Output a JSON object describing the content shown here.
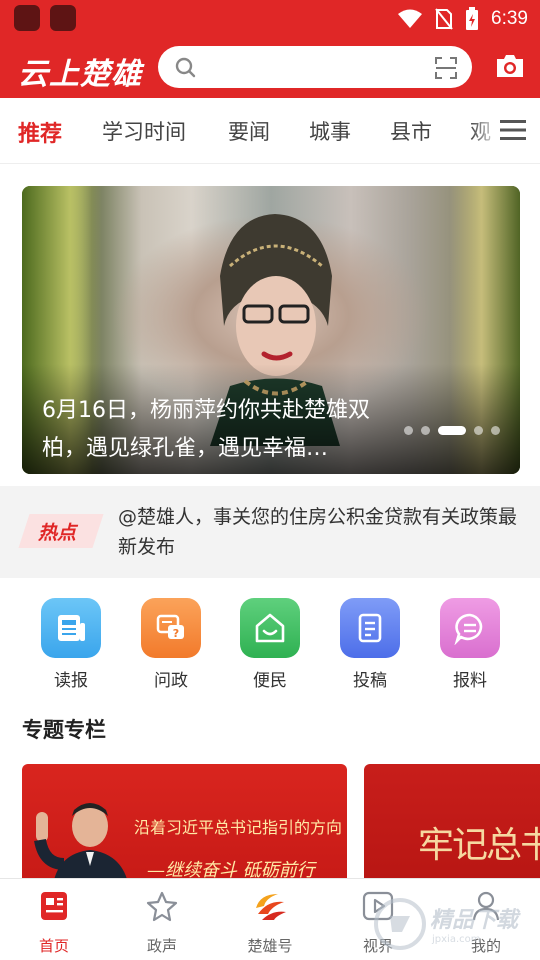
{
  "status_bar": {
    "time": "6:39",
    "icons": [
      "app-icon",
      "app-icon",
      "wifi-icon",
      "no-sim-icon",
      "battery-icon"
    ]
  },
  "header": {
    "app_name": "云上楚雄",
    "search_placeholder": "",
    "icons": [
      "search-icon",
      "scan-icon",
      "camera-icon"
    ]
  },
  "tabs": [
    {
      "label": "推荐",
      "active": true
    },
    {
      "label": "学习时间"
    },
    {
      "label": "要闻"
    },
    {
      "label": "城事"
    },
    {
      "label": "县市"
    },
    {
      "label": "观"
    }
  ],
  "banner": {
    "title": "6月16日，杨丽萍约你共赴楚雄双柏，遇见绿孔雀，遇见幸福…",
    "slide_count": 5,
    "active_slide": 3
  },
  "hot": {
    "badge": "热点",
    "text": "@楚雄人，事关您的住房公积金贷款有关政策最新发布"
  },
  "quick_actions": [
    {
      "label": "读报",
      "icon": "newspaper-icon",
      "color": "#4fb2ee"
    },
    {
      "label": "问政",
      "icon": "question-chat-icon",
      "color": "#f58a3c"
    },
    {
      "label": "便民",
      "icon": "home-smile-icon",
      "color": "#3fbf63"
    },
    {
      "label": "投稿",
      "icon": "document-icon",
      "color": "#5b7ff0"
    },
    {
      "label": "报料",
      "icon": "chat-bubble-icon",
      "color": "#e37ad3"
    }
  ],
  "special": {
    "title": "专题专栏",
    "cards": [
      {
        "line1": "沿着习近平总书记指引的方向",
        "line2": "—继续奋斗 砥砺前行"
      },
      {
        "line1": "牢记总书记嘱"
      }
    ]
  },
  "bottom_nav": [
    {
      "label": "首页",
      "icon": "news-home-icon",
      "active": true
    },
    {
      "label": "政声",
      "icon": "star-icon"
    },
    {
      "label": "楚雄号",
      "icon": "chuxiong-logo-icon"
    },
    {
      "label": "视界",
      "icon": "play-icon"
    },
    {
      "label": "我的",
      "icon": "user-icon"
    }
  ],
  "watermark": {
    "text": "精品下载",
    "sub": "jpxia.com"
  },
  "colors": {
    "brand": "#e02727",
    "text": "#333333"
  }
}
